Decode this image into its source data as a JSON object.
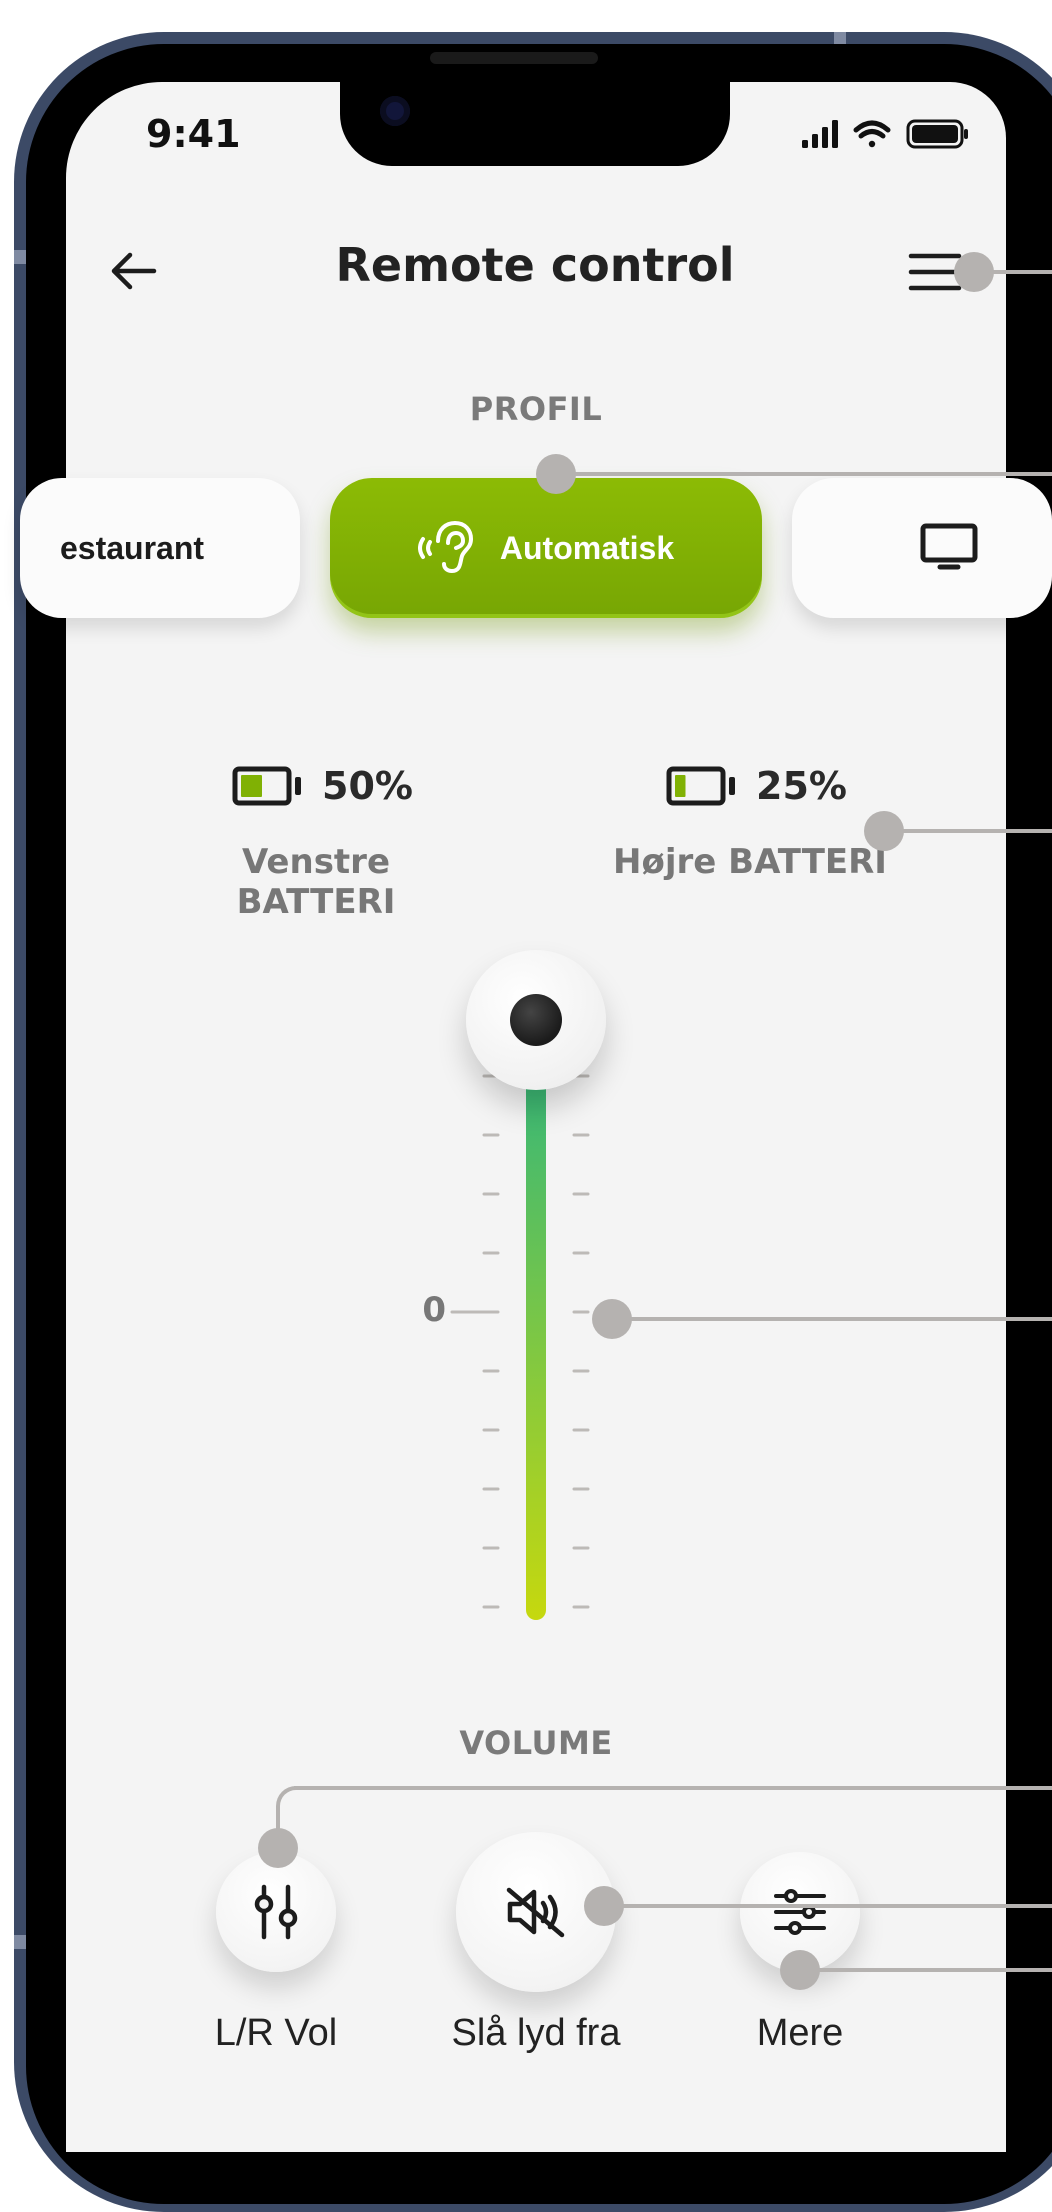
{
  "status_bar": {
    "time": "9:41"
  },
  "header": {
    "title": "Remote control"
  },
  "profile": {
    "section_label": "PROFIL",
    "items": [
      {
        "label": "estaurant",
        "icon": "none"
      },
      {
        "label": "Automatisk",
        "icon": "ear-icon",
        "active": true
      },
      {
        "label": "",
        "icon": "tv-icon"
      }
    ],
    "active_color": "#80b104"
  },
  "battery": {
    "left": {
      "percent": "50%",
      "label": "Venstre BATTERI",
      "level": 0.5
    },
    "right": {
      "percent": "25%",
      "label": "Højre BATTERI",
      "level": 0.25
    },
    "fill_color": "#80b104"
  },
  "volume": {
    "zero_label": "0",
    "section_label": "VOLUME",
    "gradient": [
      "#2fb57e",
      "#c6d80e"
    ]
  },
  "controls": [
    {
      "label": "L/R Vol",
      "icon": "balance-sliders-icon"
    },
    {
      "label": "Slå lyd fra",
      "icon": "mute-icon"
    },
    {
      "label": "Mere",
      "icon": "settings-sliders-icon"
    }
  ]
}
